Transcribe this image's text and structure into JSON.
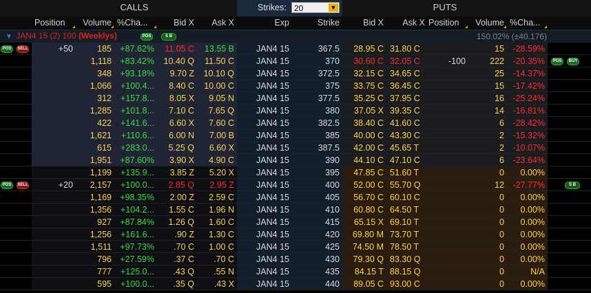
{
  "header": {
    "calls_label": "CALLS",
    "puts_label": "PUTS",
    "strikes_label": "Strikes:",
    "strikes_value": "20"
  },
  "columns": {
    "call_position": "Position",
    "call_volume": "Volume",
    "call_change": "%Cha...",
    "call_bid": "Bid X",
    "call_ask": "Ask X",
    "exp": "Exp",
    "strike": "Strike",
    "put_bid": "Bid X",
    "put_ask": "Ask X",
    "put_position": "Position",
    "put_volume": "Volume",
    "put_change": "%Cha..."
  },
  "group": {
    "expiration": "JAN4 15",
    "count": "(2)",
    "multiplier": "100",
    "type": "(Weeklys)",
    "summary": "150.02% (±40.176)",
    "badge_pos": "POS",
    "badge_sb": "S B"
  },
  "badges": {
    "pos": "POS",
    "sell": "SELL",
    "buy": "BUY",
    "sb": "S B"
  },
  "colors": {
    "positive": "#3cdc3c",
    "negative": "#ff2a2a",
    "value": "#ffd24a",
    "text": "#d8d8d8",
    "itm_calls_bg": "#1f2436",
    "otm_calls_bg": "#0e0f14",
    "itm_puts_bg": "#2b1c10",
    "otm_puts_bg": "#1b1c20",
    "center_bg": "#121e2c"
  },
  "rows": [
    {
      "call_pos": "+50",
      "call_vol": "185",
      "call_chg": "+87.62%",
      "call_bid": "11.05 C",
      "call_ask": "13.55 B",
      "exp": "JAN4 15",
      "strike": "367.5",
      "put_bid": "28.95 C",
      "put_ask": "31.80 C",
      "put_pos": "",
      "put_vol": "15",
      "put_chg": "-28.59%",
      "call_bid_color": "red",
      "call_ask_color": "green",
      "put_bid_color": "yellow",
      "put_ask_color": "yellow",
      "itm_call": true,
      "left_badges": [
        "pos",
        "sell"
      ],
      "right_badges": []
    },
    {
      "call_pos": "",
      "call_vol": "1,118",
      "call_chg": "+83.42%",
      "call_bid": "10.40 Q",
      "call_ask": "11.50 C",
      "exp": "JAN4 15",
      "strike": "370",
      "put_bid": "30.60 C",
      "put_ask": "32.05 C",
      "put_pos": "-100",
      "put_vol": "222",
      "put_chg": "-20.35%",
      "call_bid_color": "yellow",
      "call_ask_color": "yellow",
      "put_bid_color": "red",
      "put_ask_color": "red",
      "itm_call": true,
      "left_badges": [],
      "right_badges": [
        "pos",
        "buy"
      ]
    },
    {
      "call_pos": "",
      "call_vol": "348",
      "call_chg": "+93.18%",
      "call_bid": "9.70 Z",
      "call_ask": "10.10 Q",
      "exp": "JAN4 15",
      "strike": "372.5",
      "put_bid": "32.15 C",
      "put_ask": "34.65 C",
      "put_pos": "",
      "put_vol": "25",
      "put_chg": "-14.37%",
      "call_bid_color": "yellow",
      "call_ask_color": "yellow",
      "put_bid_color": "yellow",
      "put_ask_color": "yellow",
      "itm_call": true,
      "left_badges": [],
      "right_badges": []
    },
    {
      "call_pos": "",
      "call_vol": "1,066",
      "call_chg": "+100.4...",
      "call_bid": "8.40 C",
      "call_ask": "10.00 C",
      "exp": "JAN4 15",
      "strike": "375",
      "put_bid": "33.75 C",
      "put_ask": "36.45 C",
      "put_pos": "",
      "put_vol": "15",
      "put_chg": "-17.42%",
      "call_bid_color": "yellow",
      "call_ask_color": "yellow",
      "put_bid_color": "yellow",
      "put_ask_color": "yellow",
      "itm_call": true,
      "left_badges": [],
      "right_badges": []
    },
    {
      "call_pos": "",
      "call_vol": "312",
      "call_chg": "+157.8...",
      "call_bid": "8.05 X",
      "call_ask": "9.05 N",
      "exp": "JAN4 15",
      "strike": "377.5",
      "put_bid": "35.25 C",
      "put_ask": "37.95 C",
      "put_pos": "",
      "put_vol": "16",
      "put_chg": "-25.24%",
      "call_bid_color": "yellow",
      "call_ask_color": "yellow",
      "put_bid_color": "yellow",
      "put_ask_color": "yellow",
      "itm_call": true,
      "left_badges": [],
      "right_badges": []
    },
    {
      "call_pos": "",
      "call_vol": "1,285",
      "call_chg": "+101.8...",
      "call_bid": "7.10 C",
      "call_ask": "7.65 Q",
      "exp": "JAN4 15",
      "strike": "380",
      "put_bid": "37.05 X",
      "put_ask": "39.35 C",
      "put_pos": "",
      "put_vol": "14",
      "put_chg": "-16.81%",
      "call_bid_color": "yellow",
      "call_ask_color": "yellow",
      "put_bid_color": "yellow",
      "put_ask_color": "yellow",
      "itm_call": true,
      "left_badges": [],
      "right_badges": []
    },
    {
      "call_pos": "",
      "call_vol": "422",
      "call_chg": "+141.6...",
      "call_bid": "6.60 X",
      "call_ask": "7.60 C",
      "exp": "JAN4 15",
      "strike": "382.5",
      "put_bid": "38.40 C",
      "put_ask": "41.60 C",
      "put_pos": "",
      "put_vol": "6",
      "put_chg": "-28.42%",
      "call_bid_color": "yellow",
      "call_ask_color": "yellow",
      "put_bid_color": "yellow",
      "put_ask_color": "yellow",
      "itm_call": true,
      "left_badges": [],
      "right_badges": []
    },
    {
      "call_pos": "",
      "call_vol": "1,621",
      "call_chg": "+110.6...",
      "call_bid": "6.00 N",
      "call_ask": "7.00 B",
      "exp": "JAN4 15",
      "strike": "385",
      "put_bid": "40.00 C",
      "put_ask": "43.30 C",
      "put_pos": "",
      "put_vol": "2",
      "put_chg": "-15.32%",
      "call_bid_color": "yellow",
      "call_ask_color": "yellow",
      "put_bid_color": "yellow",
      "put_ask_color": "yellow",
      "itm_call": true,
      "left_badges": [],
      "right_badges": []
    },
    {
      "call_pos": "",
      "call_vol": "615",
      "call_chg": "+283.0...",
      "call_bid": "5.25 Q",
      "call_ask": "6.60 X",
      "exp": "JAN4 15",
      "strike": "387.5",
      "put_bid": "42.00 C",
      "put_ask": "45.65 T",
      "put_pos": "",
      "put_vol": "2",
      "put_chg": "-10.07%",
      "call_bid_color": "yellow",
      "call_ask_color": "yellow",
      "put_bid_color": "yellow",
      "put_ask_color": "yellow",
      "itm_call": true,
      "left_badges": [],
      "right_badges": []
    },
    {
      "call_pos": "",
      "call_vol": "1,951",
      "call_chg": "+87.60%",
      "call_bid": "3.90 X",
      "call_ask": "4.90 C",
      "exp": "JAN4 15",
      "strike": "390",
      "put_bid": "44.10 C",
      "put_ask": "47.10 C",
      "put_pos": "",
      "put_vol": "6",
      "put_chg": "-23.64%",
      "call_bid_color": "yellow",
      "call_ask_color": "yellow",
      "put_bid_color": "yellow",
      "put_ask_color": "yellow",
      "itm_call": true,
      "left_badges": [],
      "right_badges": []
    },
    {
      "call_pos": "",
      "call_vol": "1,199",
      "call_chg": "+135.9...",
      "call_bid": "3.85 Z",
      "call_ask": "5.20 X",
      "exp": "JAN4 15",
      "strike": "395",
      "put_bid": "47.85 C",
      "put_ask": "51.60 T",
      "put_pos": "",
      "put_vol": "0",
      "put_chg": "0.00%",
      "call_bid_color": "yellow",
      "call_ask_color": "yellow",
      "put_bid_color": "yellow",
      "put_ask_color": "yellow",
      "itm_call": false,
      "left_badges": [],
      "right_badges": []
    },
    {
      "call_pos": "+20",
      "call_vol": "2,157",
      "call_chg": "+100.0...",
      "call_bid": "2.85 Q",
      "call_ask": "2.95 Z",
      "exp": "JAN4 15",
      "strike": "400",
      "put_bid": "52.00 C",
      "put_ask": "55.70 Q",
      "put_pos": "",
      "put_vol": "12",
      "put_chg": "-27.77%",
      "call_bid_color": "red",
      "call_ask_color": "red",
      "put_bid_color": "yellow",
      "put_ask_color": "yellow",
      "itm_call": false,
      "left_badges": [
        "pos",
        "sell"
      ],
      "right_badges": [
        "sb"
      ]
    },
    {
      "call_pos": "",
      "call_vol": "1,169",
      "call_chg": "+98.35%",
      "call_bid": "2.00 Z",
      "call_ask": "2.59 C",
      "exp": "JAN4 15",
      "strike": "405",
      "put_bid": "56.70 C",
      "put_ask": "60.10 C",
      "put_pos": "",
      "put_vol": "0",
      "put_chg": "0.00%",
      "call_bid_color": "yellow",
      "call_ask_color": "yellow",
      "put_bid_color": "yellow",
      "put_ask_color": "yellow",
      "itm_call": false,
      "left_badges": [],
      "right_badges": []
    },
    {
      "call_pos": "",
      "call_vol": "1,356",
      "call_chg": "+104.2...",
      "call_bid": "1.55 C",
      "call_ask": "1.96 N",
      "exp": "JAN4 15",
      "strike": "410",
      "put_bid": "60.80 C",
      "put_ask": "64.50 T",
      "put_pos": "",
      "put_vol": "0",
      "put_chg": "0.00%",
      "call_bid_color": "yellow",
      "call_ask_color": "yellow",
      "put_bid_color": "yellow",
      "put_ask_color": "yellow",
      "itm_call": false,
      "left_badges": [],
      "right_badges": []
    },
    {
      "call_pos": "",
      "call_vol": "927",
      "call_chg": "+87.84%",
      "call_bid": "1.26 Q",
      "call_ask": "1.60 C",
      "exp": "JAN4 15",
      "strike": "415",
      "put_bid": "65.15 X",
      "put_ask": "69.10 T",
      "put_pos": "",
      "put_vol": "0",
      "put_chg": "0.00%",
      "call_bid_color": "yellow",
      "call_ask_color": "yellow",
      "put_bid_color": "yellow",
      "put_ask_color": "yellow",
      "itm_call": false,
      "left_badges": [],
      "right_badges": []
    },
    {
      "call_pos": "",
      "call_vol": "1,256",
      "call_chg": "+161.6...",
      "call_bid": ".90 Z",
      "call_ask": "1.30 C",
      "exp": "JAN4 15",
      "strike": "420",
      "put_bid": "69.80 M",
      "put_ask": "73.70 T",
      "put_pos": "",
      "put_vol": "0",
      "put_chg": "0.00%",
      "call_bid_color": "yellow",
      "call_ask_color": "yellow",
      "put_bid_color": "yellow",
      "put_ask_color": "yellow",
      "itm_call": false,
      "left_badges": [],
      "right_badges": []
    },
    {
      "call_pos": "",
      "call_vol": "1,511",
      "call_chg": "+97.73%",
      "call_bid": ".70 C",
      "call_ask": "1.00 C",
      "exp": "JAN4 15",
      "strike": "425",
      "put_bid": "74.50 M",
      "put_ask": "78.50 T",
      "put_pos": "",
      "put_vol": "0",
      "put_chg": "0.00%",
      "call_bid_color": "yellow",
      "call_ask_color": "yellow",
      "put_bid_color": "yellow",
      "put_ask_color": "yellow",
      "itm_call": false,
      "left_badges": [],
      "right_badges": []
    },
    {
      "call_pos": "",
      "call_vol": "796",
      "call_chg": "+27.59%",
      "call_bid": ".37 C",
      "call_ask": ".70 C",
      "exp": "JAN4 15",
      "strike": "430",
      "put_bid": "79.30 Q",
      "put_ask": "83.30 Q",
      "put_pos": "",
      "put_vol": "0",
      "put_chg": "0.00%",
      "call_bid_color": "yellow",
      "call_ask_color": "yellow",
      "put_bid_color": "yellow",
      "put_ask_color": "yellow",
      "itm_call": false,
      "left_badges": [],
      "right_badges": []
    },
    {
      "call_pos": "",
      "call_vol": "777",
      "call_chg": "+125.0...",
      "call_bid": ".43 Q",
      "call_ask": ".55 N",
      "exp": "JAN4 15",
      "strike": "435",
      "put_bid": "84.15 T",
      "put_ask": "88.15 Q",
      "put_pos": "",
      "put_vol": "0",
      "put_chg": "N/A",
      "call_bid_color": "yellow",
      "call_ask_color": "yellow",
      "put_bid_color": "yellow",
      "put_ask_color": "yellow",
      "itm_call": false,
      "left_badges": [],
      "right_badges": []
    },
    {
      "call_pos": "",
      "call_vol": "595",
      "call_chg": "+100.0...",
      "call_bid": ".35 Q",
      "call_ask": ".43 X",
      "exp": "JAN4 15",
      "strike": "440",
      "put_bid": "89.05 C",
      "put_ask": "93.00 C",
      "put_pos": "",
      "put_vol": "0",
      "put_chg": "0.00%",
      "call_bid_color": "yellow",
      "call_ask_color": "yellow",
      "put_bid_color": "yellow",
      "put_ask_color": "yellow",
      "itm_call": false,
      "left_badges": [],
      "right_badges": []
    }
  ]
}
